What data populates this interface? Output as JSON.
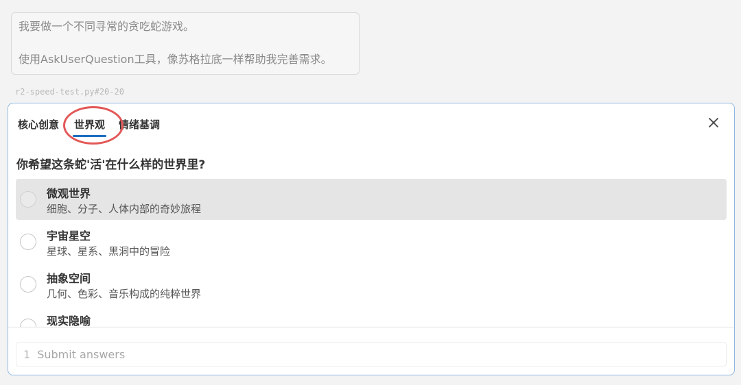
{
  "prompt": {
    "line1": "我要做一个不同寻常的贪吃蛇游戏。",
    "line2": "使用AskUserQuestion工具，像苏格拉底一样帮助我完善需求。"
  },
  "file_ref": "r2-speed-test.py#20-20",
  "tabs": [
    {
      "label": "核心创意"
    },
    {
      "label": "世界观"
    },
    {
      "label": "情绪基调"
    }
  ],
  "active_tab": "世界观",
  "question": "你希望这条蛇'活'在什么样的世界里?",
  "options": [
    {
      "title": "微观世界",
      "desc": "细胞、分子、人体内部的奇妙旅程"
    },
    {
      "title": "宇宙星空",
      "desc": "星球、星系、黑洞中的冒险"
    },
    {
      "title": "抽象空间",
      "desc": "几何、色彩、音乐构成的纯粹世界"
    },
    {
      "title": "现实隐喻",
      "desc": ""
    }
  ],
  "submit": {
    "index": "1",
    "label": "Submit answers"
  },
  "icons": {
    "close": "close-icon",
    "radio": "radio-icon"
  },
  "colors": {
    "accent": "#1e6fc0",
    "highlight_ring": "#e35757",
    "panel_border": "#8fb8e0"
  }
}
